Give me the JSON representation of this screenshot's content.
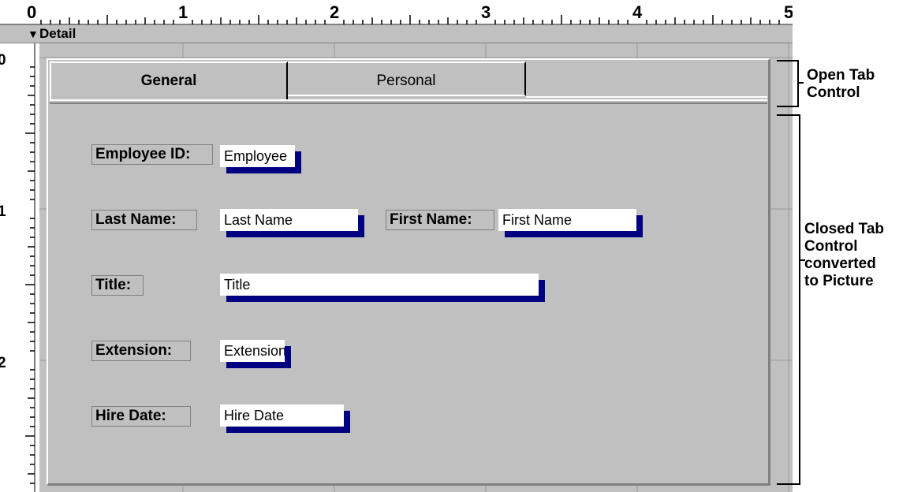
{
  "ruler": {
    "marks": [
      "0",
      "1",
      "2",
      "3",
      "4",
      "5"
    ],
    "v_marks": [
      "0",
      "1",
      "2"
    ]
  },
  "section": {
    "arrow": "▼",
    "label": "Detail"
  },
  "tabs": [
    {
      "label": "General",
      "selected": true
    },
    {
      "label": "Personal",
      "selected": false
    }
  ],
  "fields": [
    {
      "label": "Employee ID:",
      "value": "Employee"
    },
    {
      "label": "Last Name:",
      "value": "Last Name"
    },
    {
      "label": "First Name:",
      "value": "First Name"
    },
    {
      "label": "Title:",
      "value": "Title"
    },
    {
      "label": "Extension:",
      "value": "Extension"
    },
    {
      "label": "Hire Date:",
      "value": "Hire Date"
    }
  ],
  "annotations": {
    "open": "Open Tab\nControl",
    "closed": "Closed Tab\nControl\nconverted\nto Picture"
  },
  "colors": {
    "face": "#c0c0c0",
    "shadow": "#000080",
    "highlight": "#ffffff",
    "dark": "#808080"
  }
}
